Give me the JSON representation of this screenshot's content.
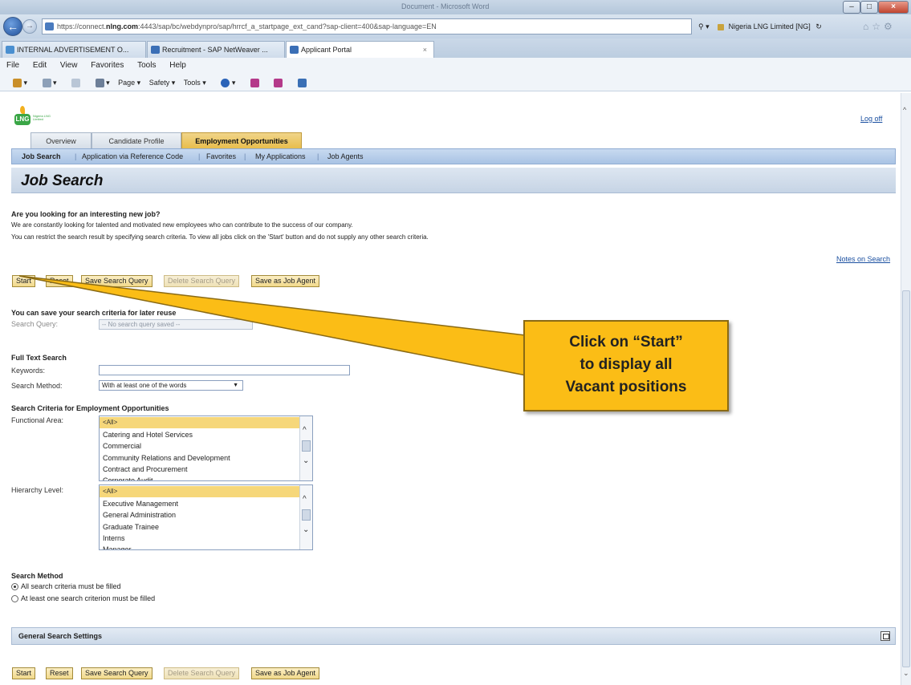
{
  "browser": {
    "window_title": "Document - Microsoft Word",
    "url_host": "https://connect.",
    "url_domain": "nlng.com",
    "url_path": ":4443/sap/bc/webdynpro/sap/hrrcf_a_startpage_ext_cand?sap-client=400&sap-language=EN",
    "search_suffix": "▾",
    "site_identity": "Nigeria LNG Limited [NG]",
    "tabs": [
      {
        "label": "INTERNAL ADVERTISEMENT O..."
      },
      {
        "label": "Recruitment - SAP NetWeaver ..."
      },
      {
        "label": "Applicant Portal",
        "close": "×"
      }
    ],
    "menu": [
      "File",
      "Edit",
      "View",
      "Favorites",
      "Tools",
      "Help"
    ],
    "command_bar": {
      "page": "Page ▾",
      "safety": "Safety ▾",
      "tools": "Tools ▾"
    }
  },
  "portal": {
    "logout": "Log off",
    "logo_text": "Nigeria LNG Limited",
    "main_tabs": [
      "Overview",
      "Candidate Profile",
      "Employment Opportunities"
    ],
    "sub_nav": [
      "Job Search",
      "Application via Reference Code",
      "Favorites",
      "My Applications",
      "Job Agents"
    ],
    "page_title": "Job Search",
    "intro_heading": "Are you looking for an interesting new job?",
    "intro_line1": "We are constantly looking for talented and motivated new employees who can contribute to the success of our company.",
    "intro_line2": "You can restrict the search result by specifying search criteria. To view all jobs click on the 'Start' button and do not supply any other search criteria.",
    "notes_link": "Notes on Search",
    "buttons": {
      "start": "Start",
      "reset": "Reset",
      "save_query": "Save Search Query",
      "delete_query": "Delete Search Query",
      "save_agent": "Save as Job Agent"
    },
    "save_section": {
      "heading": "You can save your search criteria for later reuse",
      "query_label": "Search Query:",
      "query_value": "-- No search query saved --"
    },
    "full_text": {
      "heading": "Full Text Search",
      "keywords_label": "Keywords:",
      "keywords_value": "",
      "method_label": "Search Method:",
      "method_value": "With at least one of the words"
    },
    "criteria": {
      "heading": "Search Criteria for Employment Opportunities",
      "functional_label": "Functional Area:",
      "functional_options": [
        "<All>",
        "Catering and Hotel Services",
        "Commercial",
        "Community Relations and Development",
        "Contract and Procurement",
        "Corporate Audit"
      ],
      "hierarchy_label": "Hierarchy Level:",
      "hierarchy_options": [
        "<All>",
        "Executive Management",
        "General Administration",
        "Graduate Trainee",
        "Interns",
        "Manager"
      ]
    },
    "search_method": {
      "heading": "Search Method",
      "option_all": "All search criteria must be filled",
      "option_one": "At least one search criterion must be filled",
      "selected": "all"
    },
    "general_settings": "General Search Settings"
  },
  "callout": {
    "text": "Click on “Start”\nto display all\nVacant positions",
    "color": "#fbbd16"
  }
}
